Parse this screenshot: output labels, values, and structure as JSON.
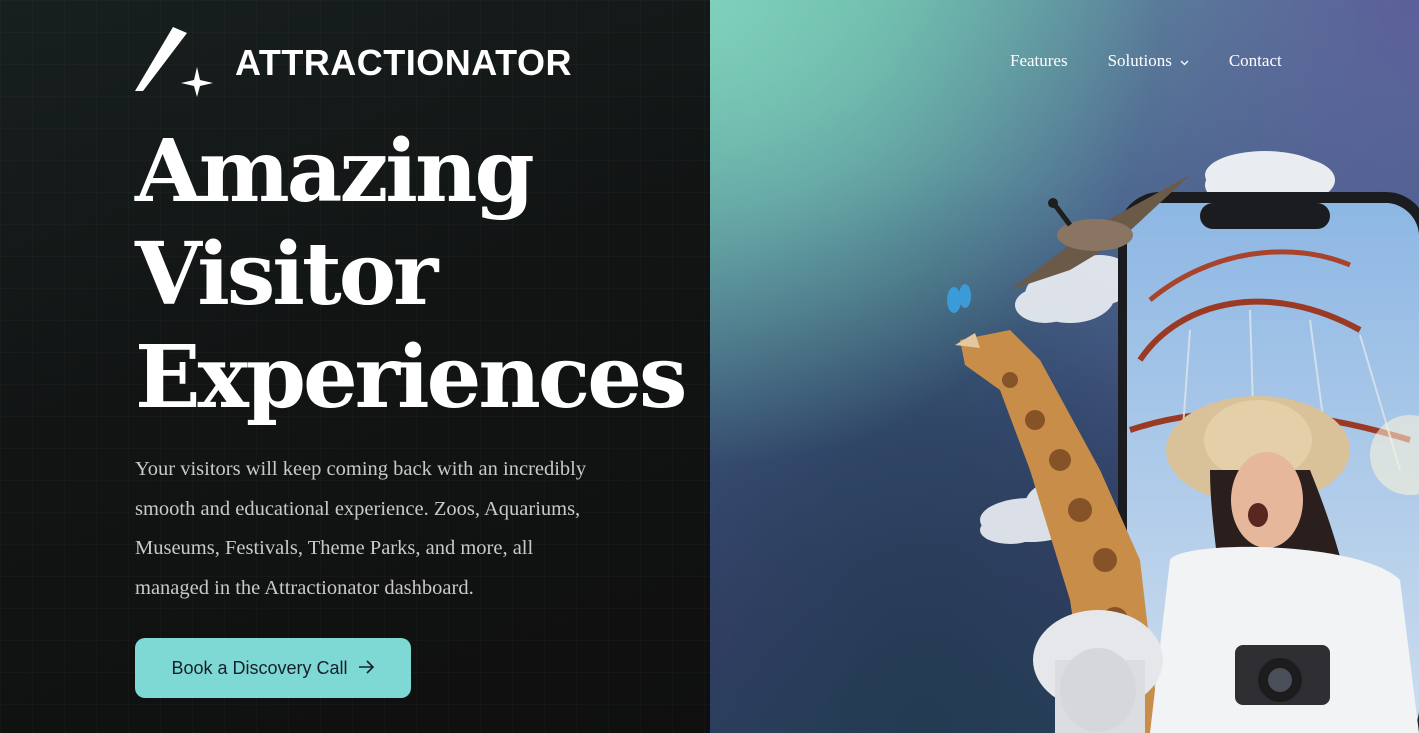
{
  "brand": {
    "name": "ATTRACTIONATOR",
    "logo_icon": "star-sparkle-icon"
  },
  "nav": {
    "items": [
      {
        "label": "Features"
      },
      {
        "label": "Solutions",
        "icon": "chevron-down-icon"
      },
      {
        "label": "Contact"
      }
    ]
  },
  "hero": {
    "headline": [
      "Amazing",
      "Visitor",
      "Experiences"
    ],
    "subtext_lines": [
      "Your visitors will keep coming back with an incredibly",
      "smooth and educational experience. Zoos, Aquariums,",
      "Museums, Festivals, Theme Parks, and more, all",
      "managed in the Attractionator dashboard."
    ],
    "cta_label": "Book a Discovery Call",
    "cta_icon": "arrow-right-icon"
  },
  "colors": {
    "left_bg": "#121212",
    "accent": "#7ed8d3",
    "right_bg_top": "#7fd0bb",
    "right_bg_bottom": "#3a3f6e"
  }
}
